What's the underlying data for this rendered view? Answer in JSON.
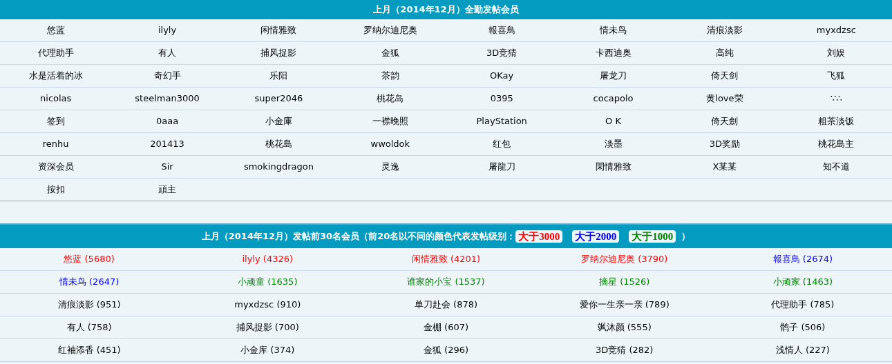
{
  "attendance": {
    "title": "上月（2014年12月）全勤发帖会员",
    "rows": [
      [
        "悠蓝",
        "ilyly",
        "闲情雅致",
        "罗纳尔迪尼奥",
        "報喜鳥",
        "情未鸟",
        "清痕淡影",
        "myxdzsc"
      ],
      [
        "代理助手",
        "有人",
        "捕风捉影",
        "金狐",
        "3D竞猜",
        "卡西迪奥",
        "高纯",
        "刘娱"
      ],
      [
        "水是活着的冰",
        "奇幻手",
        "乐阳",
        "茶韵",
        "OKay",
        "屠龙刀",
        "倚天剑",
        "飞狐"
      ],
      [
        "nicolas",
        "steelman3000",
        "super2046",
        "桃花岛",
        "0395",
        "cocapolo",
        "黄love荣",
        "∵∴"
      ],
      [
        "签到",
        "0aaa",
        "小金庫",
        "一襟晚照",
        "PlayStation",
        "O K",
        "倚天劍",
        "粗茶淡饭"
      ],
      [
        "renhu",
        "201413",
        "桃花島",
        "wwoldok",
        "红包",
        "淡墨",
        "3D奖励",
        "桃花島主"
      ],
      [
        "资深会员",
        "Sir",
        "smokingdragon",
        "灵逸",
        "屠龍刀",
        "閑情雅致",
        "X某某",
        "知不道"
      ],
      [
        "按扣",
        "頑主"
      ]
    ]
  },
  "top_posters": {
    "title": "上月（2014年12月）发帖前30名会员（前20名以不同的颜色代表发帖级别：",
    "title_end": "）",
    "legend": [
      {
        "label": "大于3000",
        "color": "#ff0000"
      },
      {
        "label": "大于2000",
        "color": "#0000ff"
      },
      {
        "label": "大于1000",
        "color": "#008000"
      }
    ],
    "rows": [
      [
        {
          "text": "悠蓝 (5680)",
          "color": "#ff0000"
        },
        {
          "text": "ilyly (4326)",
          "color": "#ff0000"
        },
        {
          "text": "闲情雅致 (4201)",
          "color": "#ff0000"
        },
        {
          "text": "罗纳尔迪尼奥 (3790)",
          "color": "#ff0000"
        },
        {
          "text": "報喜鳥 (2674)",
          "color": "#0000ff"
        }
      ],
      [
        {
          "text": "情未鸟 (2647)",
          "color": "#0000ff"
        },
        {
          "text": "小顽童 (1635)",
          "color": "#008000"
        },
        {
          "text": "谁家的小宝 (1537)",
          "color": "#008000"
        },
        {
          "text": "摘星 (1526)",
          "color": "#008000"
        },
        {
          "text": "小顽家 (1463)",
          "color": "#008000"
        }
      ],
      [
        {
          "text": "清痕淡影 (951)",
          "color": "#000000"
        },
        {
          "text": "myxdzsc (910)",
          "color": "#000000"
        },
        {
          "text": "单刀赴会 (878)",
          "color": "#000000"
        },
        {
          "text": "爱你一生亲一亲 (789)",
          "color": "#000000"
        },
        {
          "text": "代理助手 (785)",
          "color": "#000000"
        }
      ],
      [
        {
          "text": "有人 (758)",
          "color": "#000000"
        },
        {
          "text": "捕风捉影 (700)",
          "color": "#000000"
        },
        {
          "text": "金棚 (607)",
          "color": "#000000"
        },
        {
          "text": "飒沐颜 (555)",
          "color": "#000000"
        },
        {
          "text": "鹘子 (506)",
          "color": "#000000"
        }
      ],
      [
        {
          "text": "红袖添香 (451)",
          "color": "#000000"
        },
        {
          "text": "小金库 (374)",
          "color": "#000000"
        },
        {
          "text": "金狐 (296)",
          "color": "#000000"
        },
        {
          "text": "3D竞猜 (282)",
          "color": "#000000"
        },
        {
          "text": "浅情人 (227)",
          "color": "#000000"
        }
      ]
    ]
  }
}
